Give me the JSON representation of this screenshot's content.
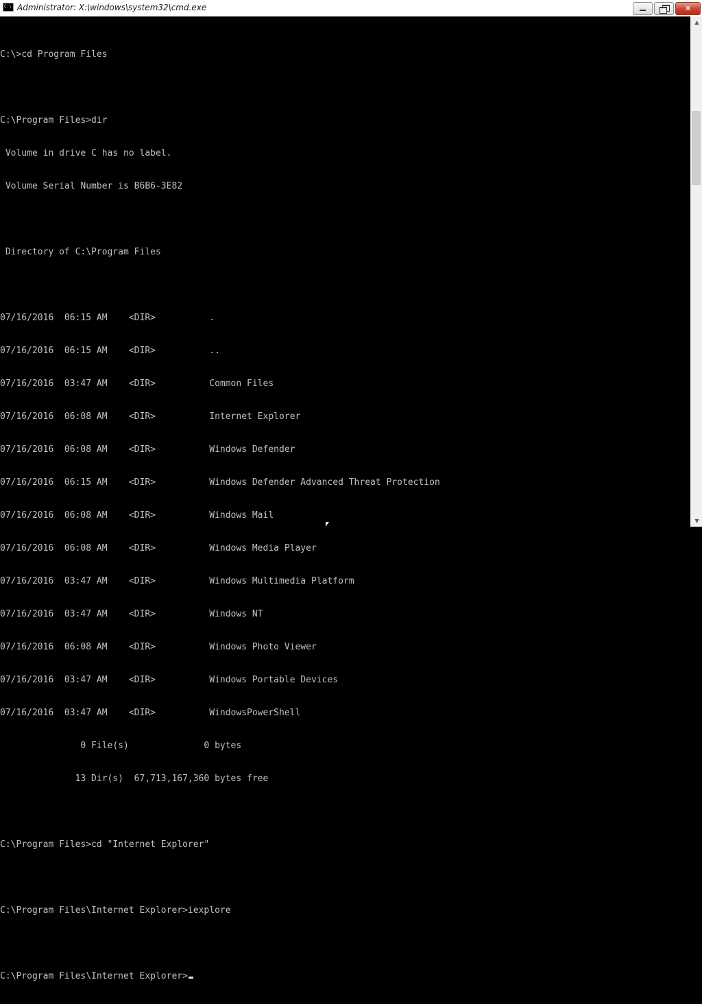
{
  "window": {
    "title": "Administrator: X:\\windows\\system32\\cmd.exe",
    "icon_text": "C:\\",
    "buttons": {
      "minimize_icon": "minimize-icon",
      "maximize_icon": "restore-icon",
      "close_glyph": "✕"
    }
  },
  "console": {
    "text_color": "#c0c0c0",
    "background": "#000000",
    "lines": [
      "C:\\>cd Program Files",
      "",
      "C:\\Program Files>dir",
      " Volume in drive C has no label.",
      " Volume Serial Number is B6B6-3E82",
      "",
      " Directory of C:\\Program Files",
      "",
      "07/16/2016  06:15 AM    <DIR>          .",
      "07/16/2016  06:15 AM    <DIR>          ..",
      "07/16/2016  03:47 AM    <DIR>          Common Files",
      "07/16/2016  06:08 AM    <DIR>          Internet Explorer",
      "07/16/2016  06:08 AM    <DIR>          Windows Defender",
      "07/16/2016  06:15 AM    <DIR>          Windows Defender Advanced Threat Protection",
      "07/16/2016  06:08 AM    <DIR>          Windows Mail",
      "07/16/2016  06:08 AM    <DIR>          Windows Media Player",
      "07/16/2016  03:47 AM    <DIR>          Windows Multimedia Platform",
      "07/16/2016  03:47 AM    <DIR>          Windows NT",
      "07/16/2016  06:08 AM    <DIR>          Windows Photo Viewer",
      "07/16/2016  03:47 AM    <DIR>          Windows Portable Devices",
      "07/16/2016  03:47 AM    <DIR>          WindowsPowerShell",
      "               0 File(s)              0 bytes",
      "              13 Dir(s)  67,713,167,360 bytes free",
      "",
      "C:\\Program Files>cd \"Internet Explorer\"",
      "",
      "C:\\Program Files\\Internet Explorer>iexplore",
      ""
    ],
    "prompt": "C:\\Program Files\\Internet Explorer>"
  },
  "scrollbar": {
    "up_arrow": "▲",
    "down_arrow": "▼",
    "position": 0.25
  }
}
